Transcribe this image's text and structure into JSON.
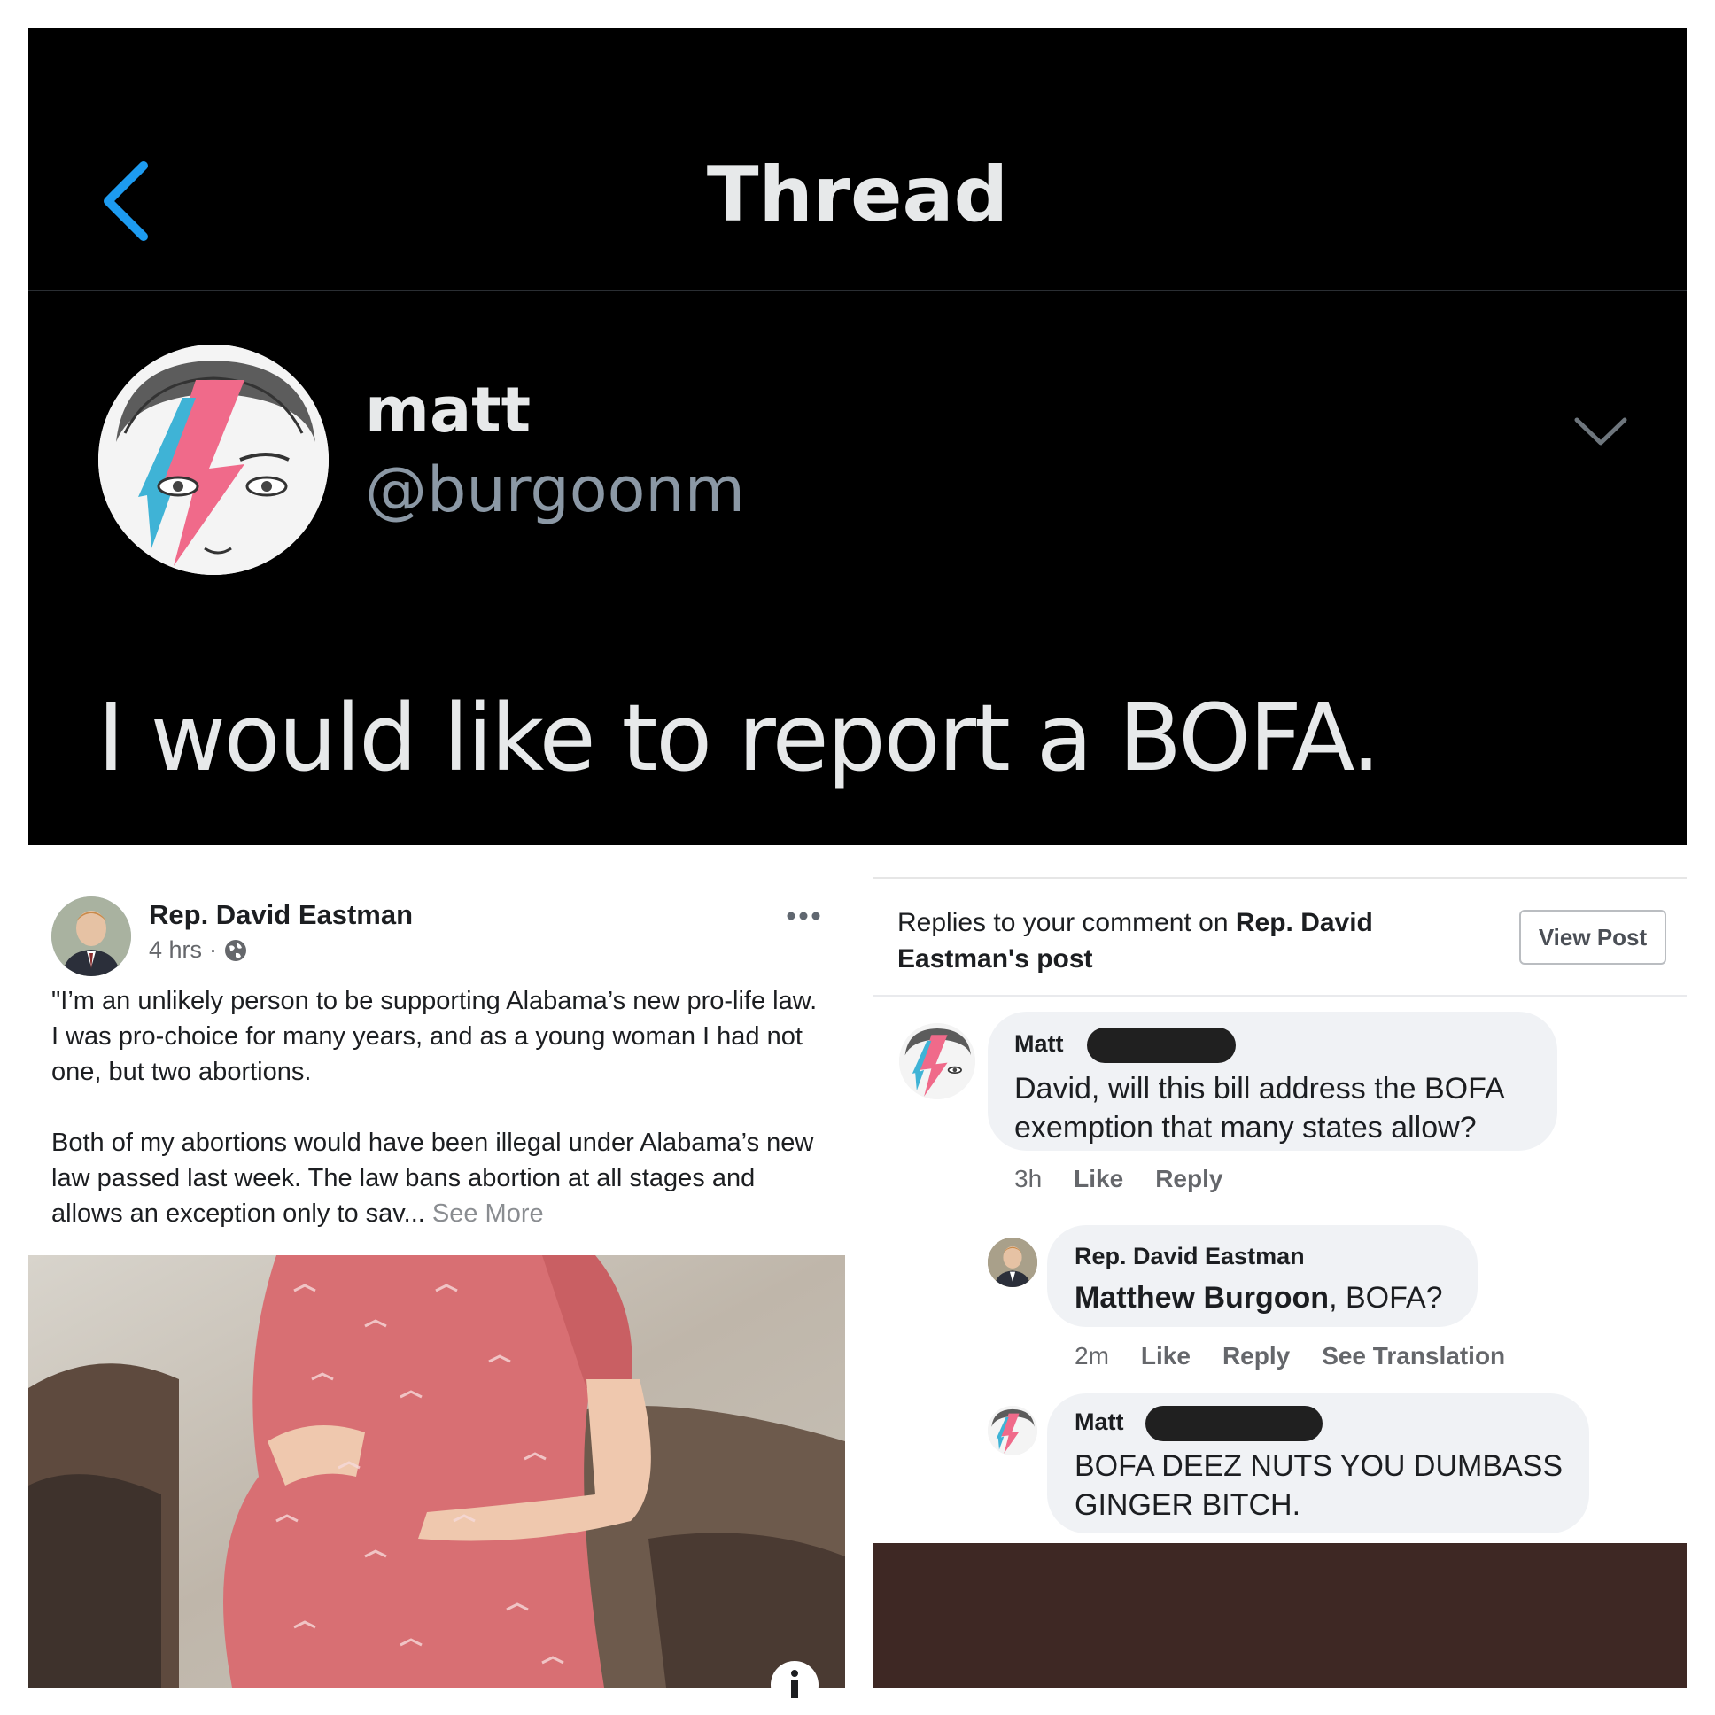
{
  "twitter": {
    "header_title": "Thread",
    "user": {
      "name": "matt",
      "handle": "@burgoonm"
    },
    "tweet_text": "I would like to report a BOFA.",
    "accent_color": "#1d9bf0"
  },
  "facebook_post": {
    "author": "Rep. David Eastman",
    "time": "4 hrs",
    "separator": "·",
    "privacy_icon": "globe-icon",
    "paragraphs": [
      "\"I’m an unlikely person to be supporting Alabama’s new pro-life law. I was pro-choice for many years, and as a young woman I had not one, but two abortions.",
      "Both of my abortions would have been illegal under Alabama’s new law passed last week. The law bans abortion at all stages and allows an exception only to sav..."
    ],
    "see_more": "See More"
  },
  "replies_panel": {
    "header_prefix": "Replies to your comment on ",
    "header_bold": "Rep. David Eastman's",
    "header_suffix": " post",
    "view_post_label": "View Post",
    "comments": [
      {
        "name_visible": "Matt",
        "text": "David, will this bill address the BOFA exemption that many states allow?",
        "time": "3h",
        "actions": [
          "Like",
          "Reply"
        ]
      },
      {
        "name": "Rep. David Eastman",
        "mention": "Matthew Burgoon",
        "text_after_mention": ", BOFA?",
        "time": "2m",
        "actions": [
          "Like",
          "Reply",
          "See Translation"
        ]
      },
      {
        "name_visible": "Matt",
        "text": "BOFA DEEZ NUTS YOU DUMBASS GINGER BITCH."
      }
    ]
  }
}
